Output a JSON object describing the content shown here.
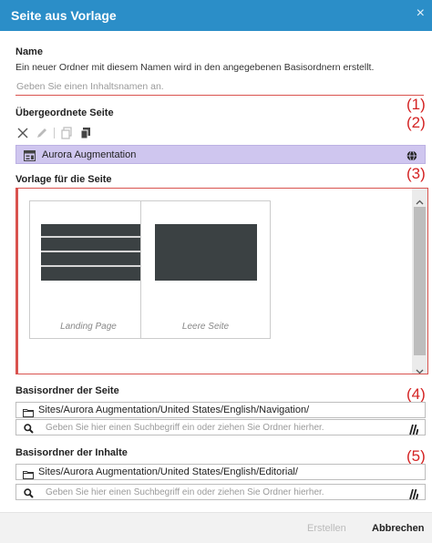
{
  "dialog": {
    "title": "Seite aus Vorlage",
    "close_glyph": "×"
  },
  "name_section": {
    "label": "Name",
    "description": "Ein neuer Ordner mit diesem Namen wird in den angegebenen Basisordnern erstellt.",
    "placeholder": "Geben Sie einen Inhaltsnamen an.",
    "value": "",
    "marker": "(1)"
  },
  "parent_section": {
    "label": "Übergeordnete Seite",
    "selected_page": "Aurora Augmentation",
    "marker": "(2)",
    "toolbar_icons": [
      "close-icon",
      "pencil-icon",
      "copy-icon",
      "paste-icon"
    ],
    "highlight_color": "#cfc6ef"
  },
  "template_section": {
    "label": "Vorlage für die Seite",
    "marker": "(3)",
    "templates": [
      {
        "name": "Landing Page",
        "selected": false
      },
      {
        "name": "Leere Seite",
        "selected": false
      }
    ]
  },
  "page_base": {
    "label": "Basisordner der Seite",
    "marker": "(4)",
    "path": "Sites/Aurora Augmentation/United States/English/Navigation/",
    "search_placeholder": "Geben Sie hier einen Suchbegriff ein oder ziehen Sie Ordner hierher."
  },
  "content_base": {
    "label": "Basisordner der Inhalte",
    "marker": "(5)",
    "path": "Sites/Aurora Augmentation/United States/English/Editorial/",
    "search_placeholder": "Geben Sie hier einen Suchbegriff ein oder ziehen Sie Ordner hierher."
  },
  "footer": {
    "create_label": "Erstellen",
    "cancel_label": "Abbrechen"
  },
  "colors": {
    "title_bar": "#2b8ec8",
    "error": "#d9534f",
    "marker": "#d42323",
    "template_thumb": "#3b4143"
  }
}
